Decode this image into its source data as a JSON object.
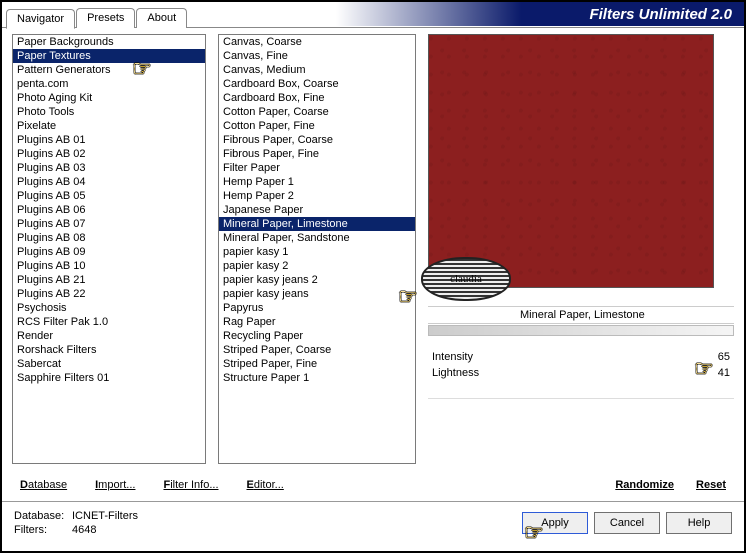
{
  "header": {
    "title": "Filters Unlimited 2.0"
  },
  "tabs": [
    "Navigator",
    "Presets",
    "About"
  ],
  "categories": [
    "Paper Backgrounds",
    "Paper Textures",
    "Pattern Generators",
    "penta.com",
    "Photo Aging Kit",
    "Photo Tools",
    "Pixelate",
    "Plugins AB 01",
    "Plugins AB 02",
    "Plugins AB 03",
    "Plugins AB 04",
    "Plugins AB 05",
    "Plugins AB 06",
    "Plugins AB 07",
    "Plugins AB 08",
    "Plugins AB 09",
    "Plugins AB 10",
    "Plugins AB 21",
    "Plugins AB 22",
    "Psychosis",
    "RCS Filter Pak 1.0",
    "Render",
    "Rorshack Filters",
    "Sabercat",
    "Sapphire Filters 01"
  ],
  "categories_selected_index": 1,
  "filters": [
    "Canvas, Coarse",
    "Canvas, Fine",
    "Canvas, Medium",
    "Cardboard Box, Coarse",
    "Cardboard Box, Fine",
    "Cotton Paper, Coarse",
    "Cotton Paper, Fine",
    "Fibrous Paper, Coarse",
    "Fibrous Paper, Fine",
    "Filter Paper",
    "Hemp Paper 1",
    "Hemp Paper 2",
    "Japanese Paper",
    "Mineral Paper, Limestone",
    "Mineral Paper, Sandstone",
    "papier kasy 1",
    "papier kasy 2",
    "papier kasy jeans 2",
    "papier kasy jeans",
    "Papyrus",
    "Rag Paper",
    "Recycling Paper",
    "Striped Paper, Coarse",
    "Striped Paper, Fine",
    "Structure Paper 1"
  ],
  "filters_selected_index": 13,
  "selected_filter_name": "Mineral Paper, Limestone",
  "watermark": "claudia",
  "params": {
    "intensity": {
      "label": "Intensity",
      "value": 65
    },
    "lightness": {
      "label": "Lightness",
      "value": 41
    }
  },
  "links": {
    "database": "Database",
    "import": "Import...",
    "filterinfo": "Filter Info...",
    "editor": "Editor...",
    "randomize": "Randomize",
    "reset": "Reset"
  },
  "footer": {
    "db_label": "Database:",
    "db_value": "ICNET-Filters",
    "filters_label": "Filters:",
    "filters_value": "4648"
  },
  "buttons": {
    "apply": "Apply",
    "cancel": "Cancel",
    "help": "Help"
  }
}
